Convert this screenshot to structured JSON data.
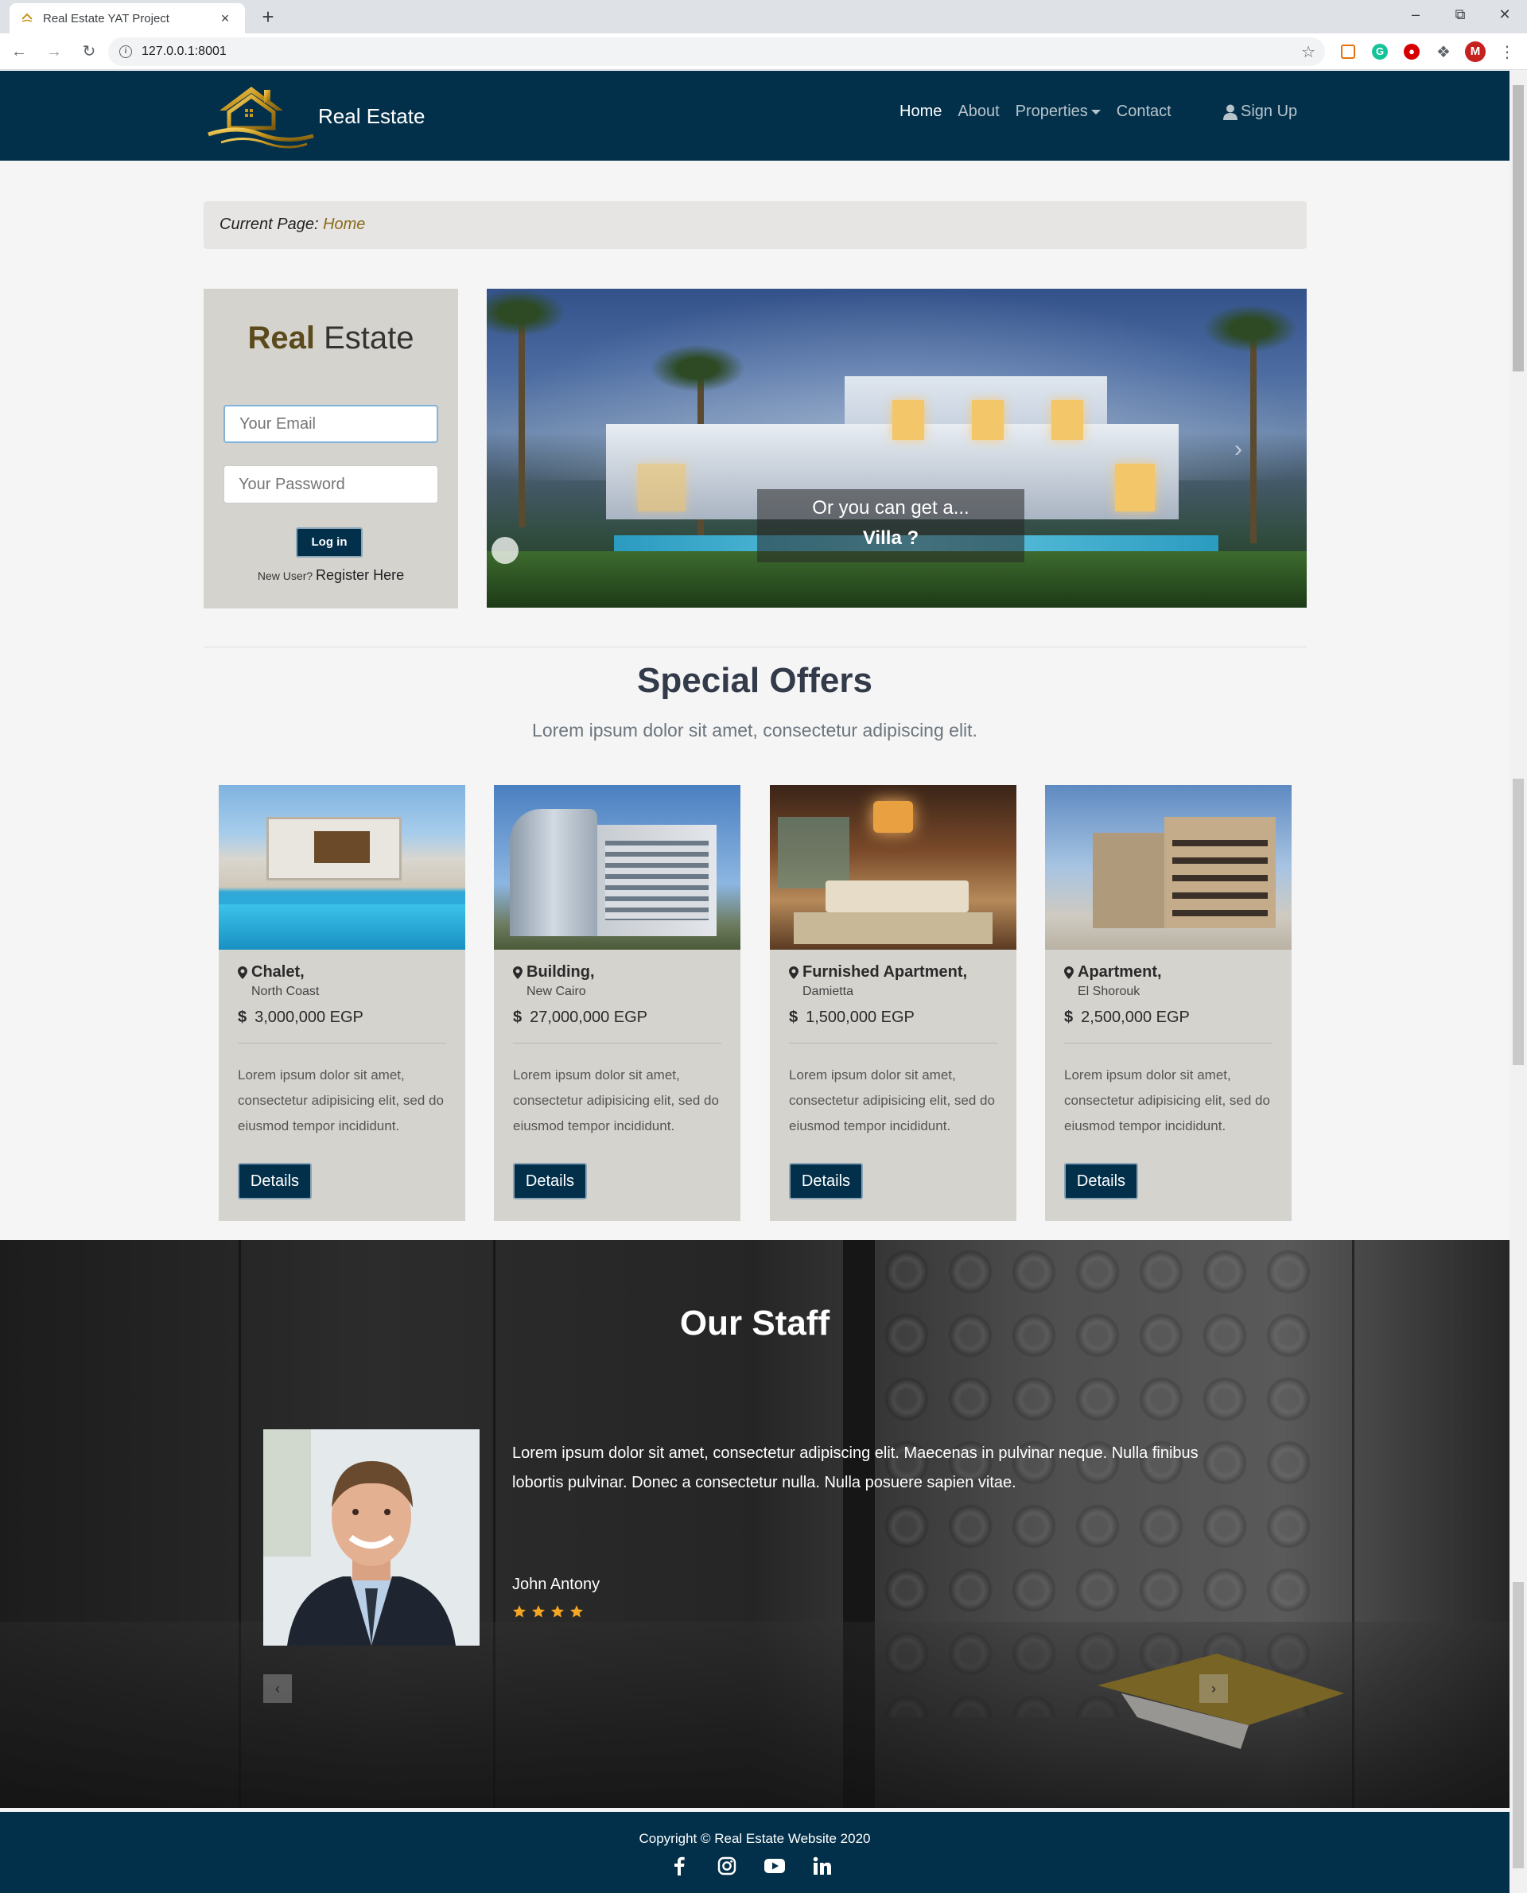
{
  "browser": {
    "tab_title": "Real Estate YAT Project",
    "tab_close": "×",
    "new_tab": "+",
    "url": "127.0.0.1:8001",
    "profile_initial": "M"
  },
  "navbar": {
    "brand": "Real Estate",
    "links": [
      "Home",
      "About",
      "Properties",
      "Contact"
    ],
    "signup": "Sign Up"
  },
  "breadcrumb": {
    "label": "Current Page:",
    "current": "Home"
  },
  "login": {
    "title_first": "Real",
    "title_second": "Estate",
    "email_placeholder": "Your Email",
    "password_placeholder": "Your Password",
    "button": "Log in",
    "new_user": "New User?",
    "register": "Register Here"
  },
  "hero": {
    "caption_line1": "Or you can get a...",
    "caption_line2": "Villa ?"
  },
  "offers": {
    "title": "Special Offers",
    "subtitle": "Lorem ipsum dolor sit amet, consectetur adipiscing elit.",
    "cards": [
      {
        "type": "Chalet,",
        "area": "North Coast",
        "price": "3,000,000 EGP",
        "desc": "Lorem ipsum dolor sit amet, consectetur adipisicing elit, sed do eiusmod tempor incididunt.",
        "button": "Details"
      },
      {
        "type": "Building,",
        "area": "New Cairo",
        "price": "27,000,000 EGP",
        "desc": "Lorem ipsum dolor sit amet, consectetur adipisicing elit, sed do eiusmod tempor incididunt.",
        "button": "Details"
      },
      {
        "type": "Furnished Apartment,",
        "area": "Damietta",
        "price": "1,500,000 EGP",
        "desc": "Lorem ipsum dolor sit amet, consectetur adipisicing elit, sed do eiusmod tempor incididunt.",
        "button": "Details"
      },
      {
        "type": "Apartment,",
        "area": "El Shorouk",
        "price": "2,500,000 EGP",
        "desc": "Lorem ipsum dolor sit amet, consectetur adipisicing elit, sed do eiusmod tempor incididunt.",
        "button": "Details"
      }
    ]
  },
  "staff": {
    "title": "Our Staff",
    "quote": "Lorem ipsum dolor sit amet, consectetur adipiscing elit. Maecenas in pulvinar neque. Nulla finibus lobortis pulvinar. Donec a consectetur nulla. Nulla posuere sapien vitae.",
    "name": "John Antony",
    "rating": 4
  },
  "footer": {
    "copyright": "Copyright © Real Estate Website 2020",
    "socials": [
      "facebook-icon",
      "instagram-icon",
      "youtube-icon",
      "linkedin-icon"
    ]
  },
  "colors": {
    "navy": "#02304a",
    "card_bg": "#d5d3ce",
    "gold": "#8a6a1a",
    "star": "#f5a623"
  }
}
